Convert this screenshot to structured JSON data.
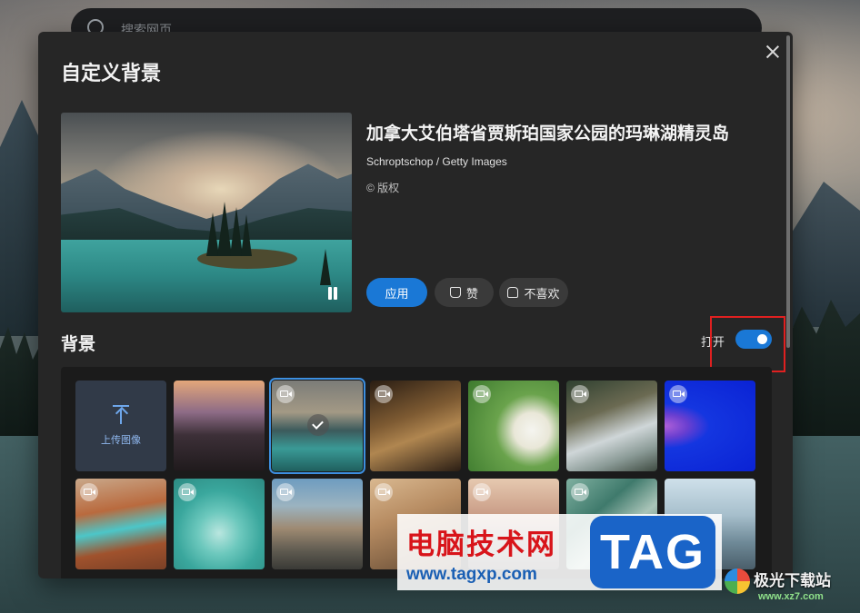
{
  "search": {
    "placeholder": "搜索网页"
  },
  "dialog": {
    "title": "自定义背景",
    "close_icon": "close-icon",
    "image": {
      "title": "加拿大艾伯塔省贾斯珀国家公园的玛琳湖精灵岛",
      "credit": "Schroptschop / Getty Images",
      "copyright": "© 版权"
    },
    "actions": {
      "apply": "应用",
      "like": "赞",
      "dislike": "不喜欢"
    },
    "background_section": {
      "title": "背景",
      "toggle_label": "打开",
      "toggle_on": true
    },
    "upload_label": "上传图像",
    "accent_color": "#1a78d6"
  },
  "watermarks": {
    "site_cn": "电脑技术网",
    "site_url": "www.tagxp.com",
    "tag": "TAG",
    "site2_cn": "极光下载站",
    "site2_url": "www.xz7.com"
  }
}
